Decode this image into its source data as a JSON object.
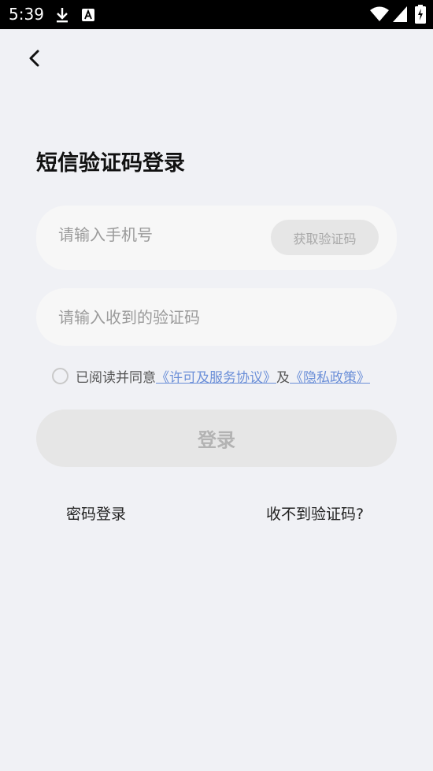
{
  "status_bar": {
    "time": "5:39",
    "icons": [
      "download-icon",
      "notification-a-icon",
      "wifi-icon",
      "signal-icon",
      "battery-icon"
    ]
  },
  "nav": {
    "back_icon": "chevron-left-icon"
  },
  "page": {
    "title": "短信验证码登录"
  },
  "phone_field": {
    "placeholder": "请输入手机号",
    "value": "",
    "get_code_label": "获取验证码"
  },
  "code_field": {
    "placeholder": "请输入收到的验证码",
    "value": ""
  },
  "agreement": {
    "checked": false,
    "prefix": "已阅读并同意",
    "license_link": "《许可及服务协议》",
    "conjunction": "及",
    "privacy_link": "《隐私政策》"
  },
  "login_button": {
    "label": "登录"
  },
  "footer": {
    "password_login": "密码登录",
    "no_code": "收不到验证码?"
  },
  "colors": {
    "background": "#f0f1f5",
    "field_bg": "#f7f7f7",
    "disabled_button": "#e6e6e6",
    "link": "#6b8fd8",
    "status_bar": "#000000"
  }
}
